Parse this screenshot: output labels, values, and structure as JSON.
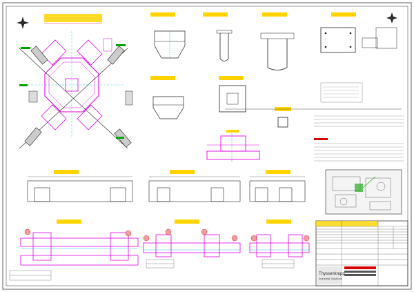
{
  "colors": {
    "structure": "#e000e0",
    "title": "#ffd400",
    "ink": "#202020",
    "cyan": "#00b7d8",
    "green": "#00a000",
    "red": "#d40000",
    "ground": "#f0a0a0"
  },
  "icons": {
    "north_arrow_left": "compass-rose-icon",
    "north_arrow_right": "compass-rose-icon"
  },
  "drawing": {
    "title_block": {
      "logo_line1": "Thyssenkrupp",
      "logo_line2": "Industrial Solutions"
    }
  }
}
